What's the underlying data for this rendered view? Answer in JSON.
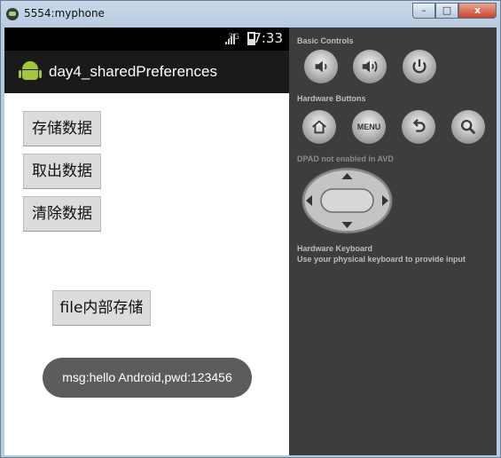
{
  "window": {
    "title": "5554:myphone",
    "min_glyph": "–",
    "max_glyph": "□",
    "close_glyph": "x"
  },
  "statusbar": {
    "network": "3G",
    "time": "7:33"
  },
  "app": {
    "title": "day4_sharedPreferences"
  },
  "buttons": {
    "store": "存储数据",
    "fetch": "取出数据",
    "clear": "清除数据",
    "file": "file内部存储"
  },
  "toast": "msg:hello Android,pwd:123456",
  "panel": {
    "basic_controls": "Basic Controls",
    "hardware_buttons": "Hardware Buttons",
    "dpad_label": "DPAD",
    "dpad_note": "not enabled in AVD",
    "keyboard_title": "Hardware Keyboard",
    "keyboard_note": "Use your physical keyboard to provide input",
    "menu_label": "MENU"
  }
}
